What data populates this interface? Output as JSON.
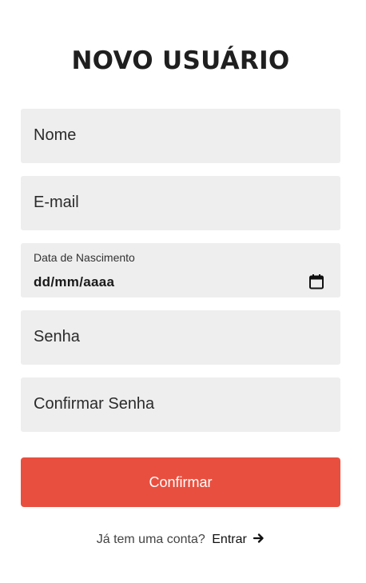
{
  "title": "NOVO USUÁRIO",
  "form": {
    "name_placeholder": "Nome",
    "email_placeholder": "E-mail",
    "birthdate_label": "Data de Nascimento",
    "birthdate_value": "dd/mm/aaaa",
    "password_placeholder": "Senha",
    "confirm_password_placeholder": "Confirmar Senha",
    "submit_label": "Confirmar"
  },
  "footer": {
    "question": "Já tem uma conta?",
    "login_link": "Entrar"
  },
  "icons": {
    "calendar": "calendar-icon",
    "arrow": "arrow-right-icon"
  },
  "colors": {
    "accent": "#e94f3f",
    "field_bg": "#eeeeee"
  }
}
